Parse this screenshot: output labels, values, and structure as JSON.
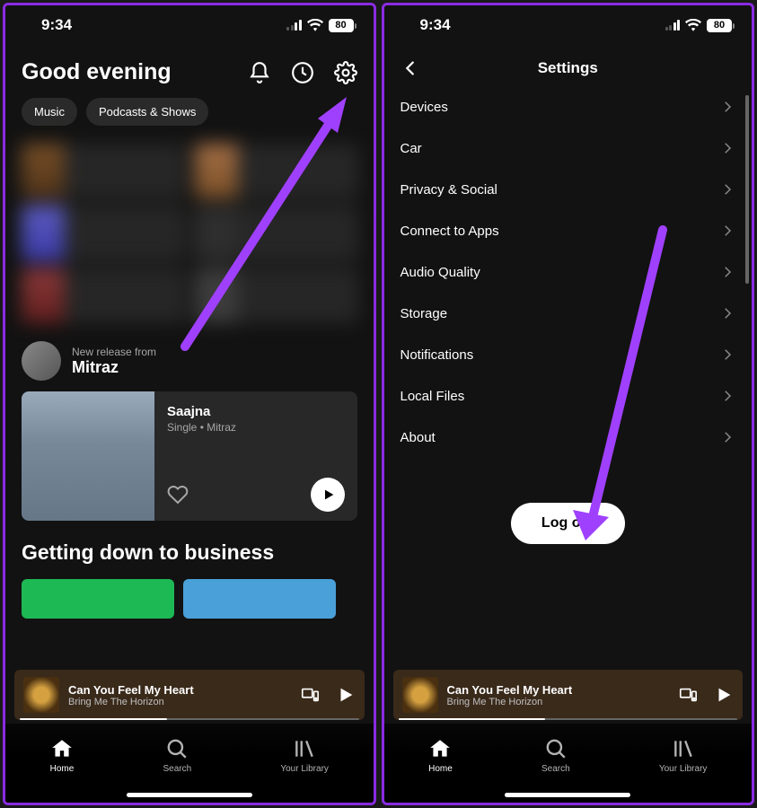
{
  "status": {
    "time": "9:34",
    "battery": "80"
  },
  "home": {
    "greeting": "Good evening",
    "chips": [
      "Music",
      "Podcasts & Shows"
    ],
    "release": {
      "prefix": "New release from",
      "artist": "Mitraz",
      "track": "Saajna",
      "meta": "Single • Mitraz"
    },
    "section2": "Getting down to business"
  },
  "now_playing": {
    "title": "Can You Feel My Heart",
    "artist": "Bring Me The Horizon"
  },
  "tabs": {
    "home": "Home",
    "search": "Search",
    "library": "Your Library"
  },
  "settings": {
    "title": "Settings",
    "items": [
      "Devices",
      "Car",
      "Privacy & Social",
      "Connect to Apps",
      "Audio Quality",
      "Storage",
      "Notifications",
      "Local Files",
      "About"
    ],
    "logout": "Log out"
  }
}
